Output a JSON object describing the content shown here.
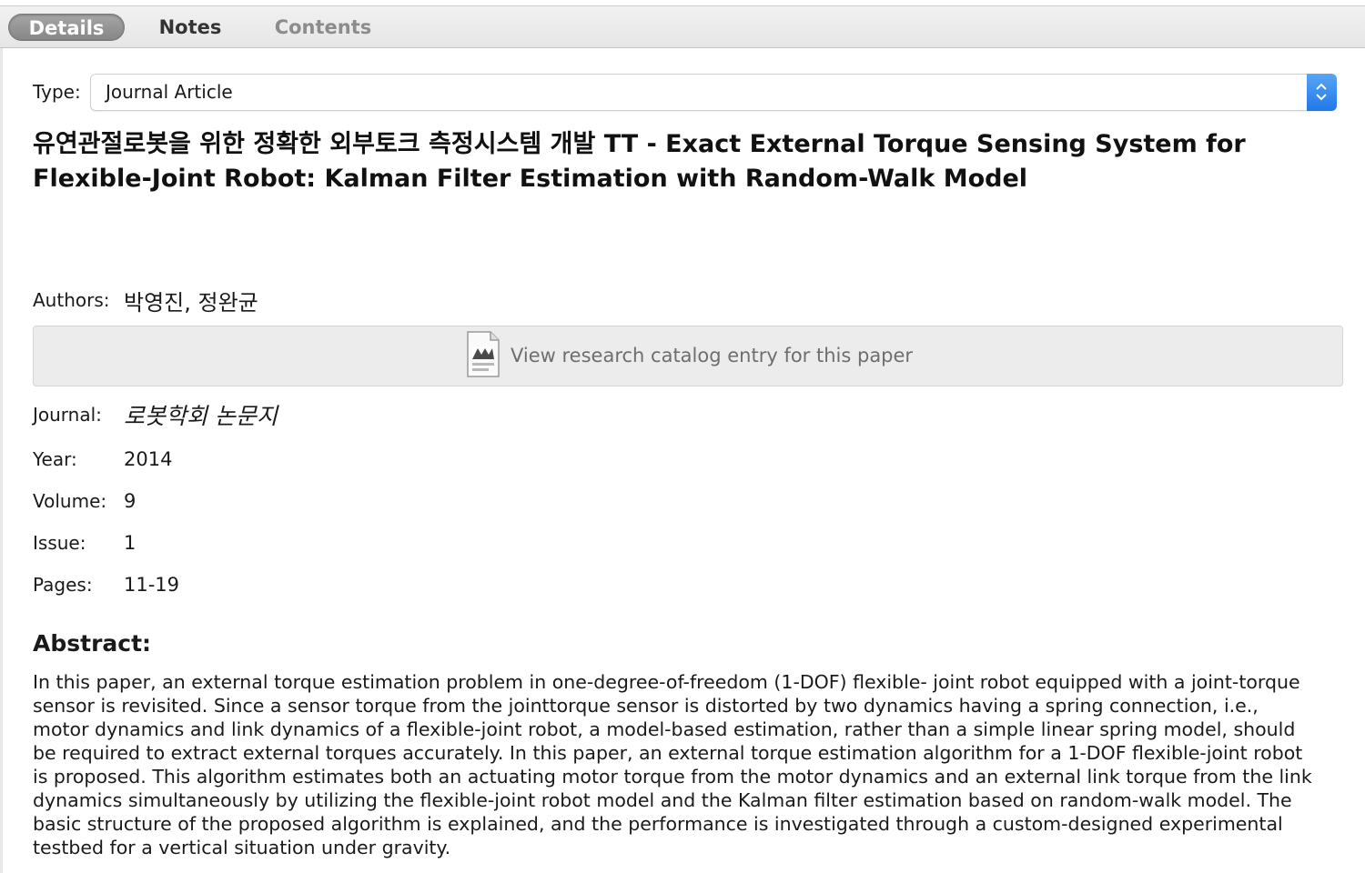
{
  "tabs": {
    "details": "Details",
    "notes": "Notes",
    "contents": "Contents"
  },
  "type": {
    "label": "Type:",
    "value": "Journal Article"
  },
  "title": "유연관절로봇을 위한 정확한 외부토크 측정시스템 개발 TT  - Exact External Torque Sensing System for Flexible-Joint Robot: Kalman Filter Estimation with Random-Walk Model",
  "authors": {
    "label": "Authors:",
    "value": "박영진, 정완균"
  },
  "catalog_button": {
    "label": "View research catalog entry for this paper",
    "icon": "document-icon"
  },
  "journal": {
    "label": "Journal:",
    "value": "로봇학회 논문지"
  },
  "year": {
    "label": "Year:",
    "value": "2014"
  },
  "volume": {
    "label": "Volume:",
    "value": "9"
  },
  "issue": {
    "label": "Issue:",
    "value": "1"
  },
  "pages": {
    "label": "Pages:",
    "value": "11-19"
  },
  "abstract": {
    "heading": "Abstract:",
    "text": "In this paper, an external torque estimation problem in one-degree-of-freedom (1-DOF) flexible- joint robot equipped with a joint-torque sensor is revisited. Since a sensor torque from the jointtorque sensor is distorted by two dynamics having a spring connection, i.e., motor dynamics and link dynamics of a flexible-joint robot, a model-based estimation, rather than a simple linear spring model, should be required to extract external torques accurately. In this paper, an external torque estimation algorithm for a 1-DOF flexible-joint robot is proposed. This algorithm estimates both an actuating motor torque from the motor dynamics and an external link torque from the link dynamics simultaneously by utilizing the flexible-joint robot model and the Kalman filter estimation based on random-walk model. The basic structure of the proposed algorithm is explained, and the performance is investigated through a custom-designed experimental testbed for a vertical situation under gravity."
  },
  "colors": {
    "accent": "#1e78e8",
    "selected_tab": "#8f8f8f",
    "button_bg": "#ececec"
  }
}
